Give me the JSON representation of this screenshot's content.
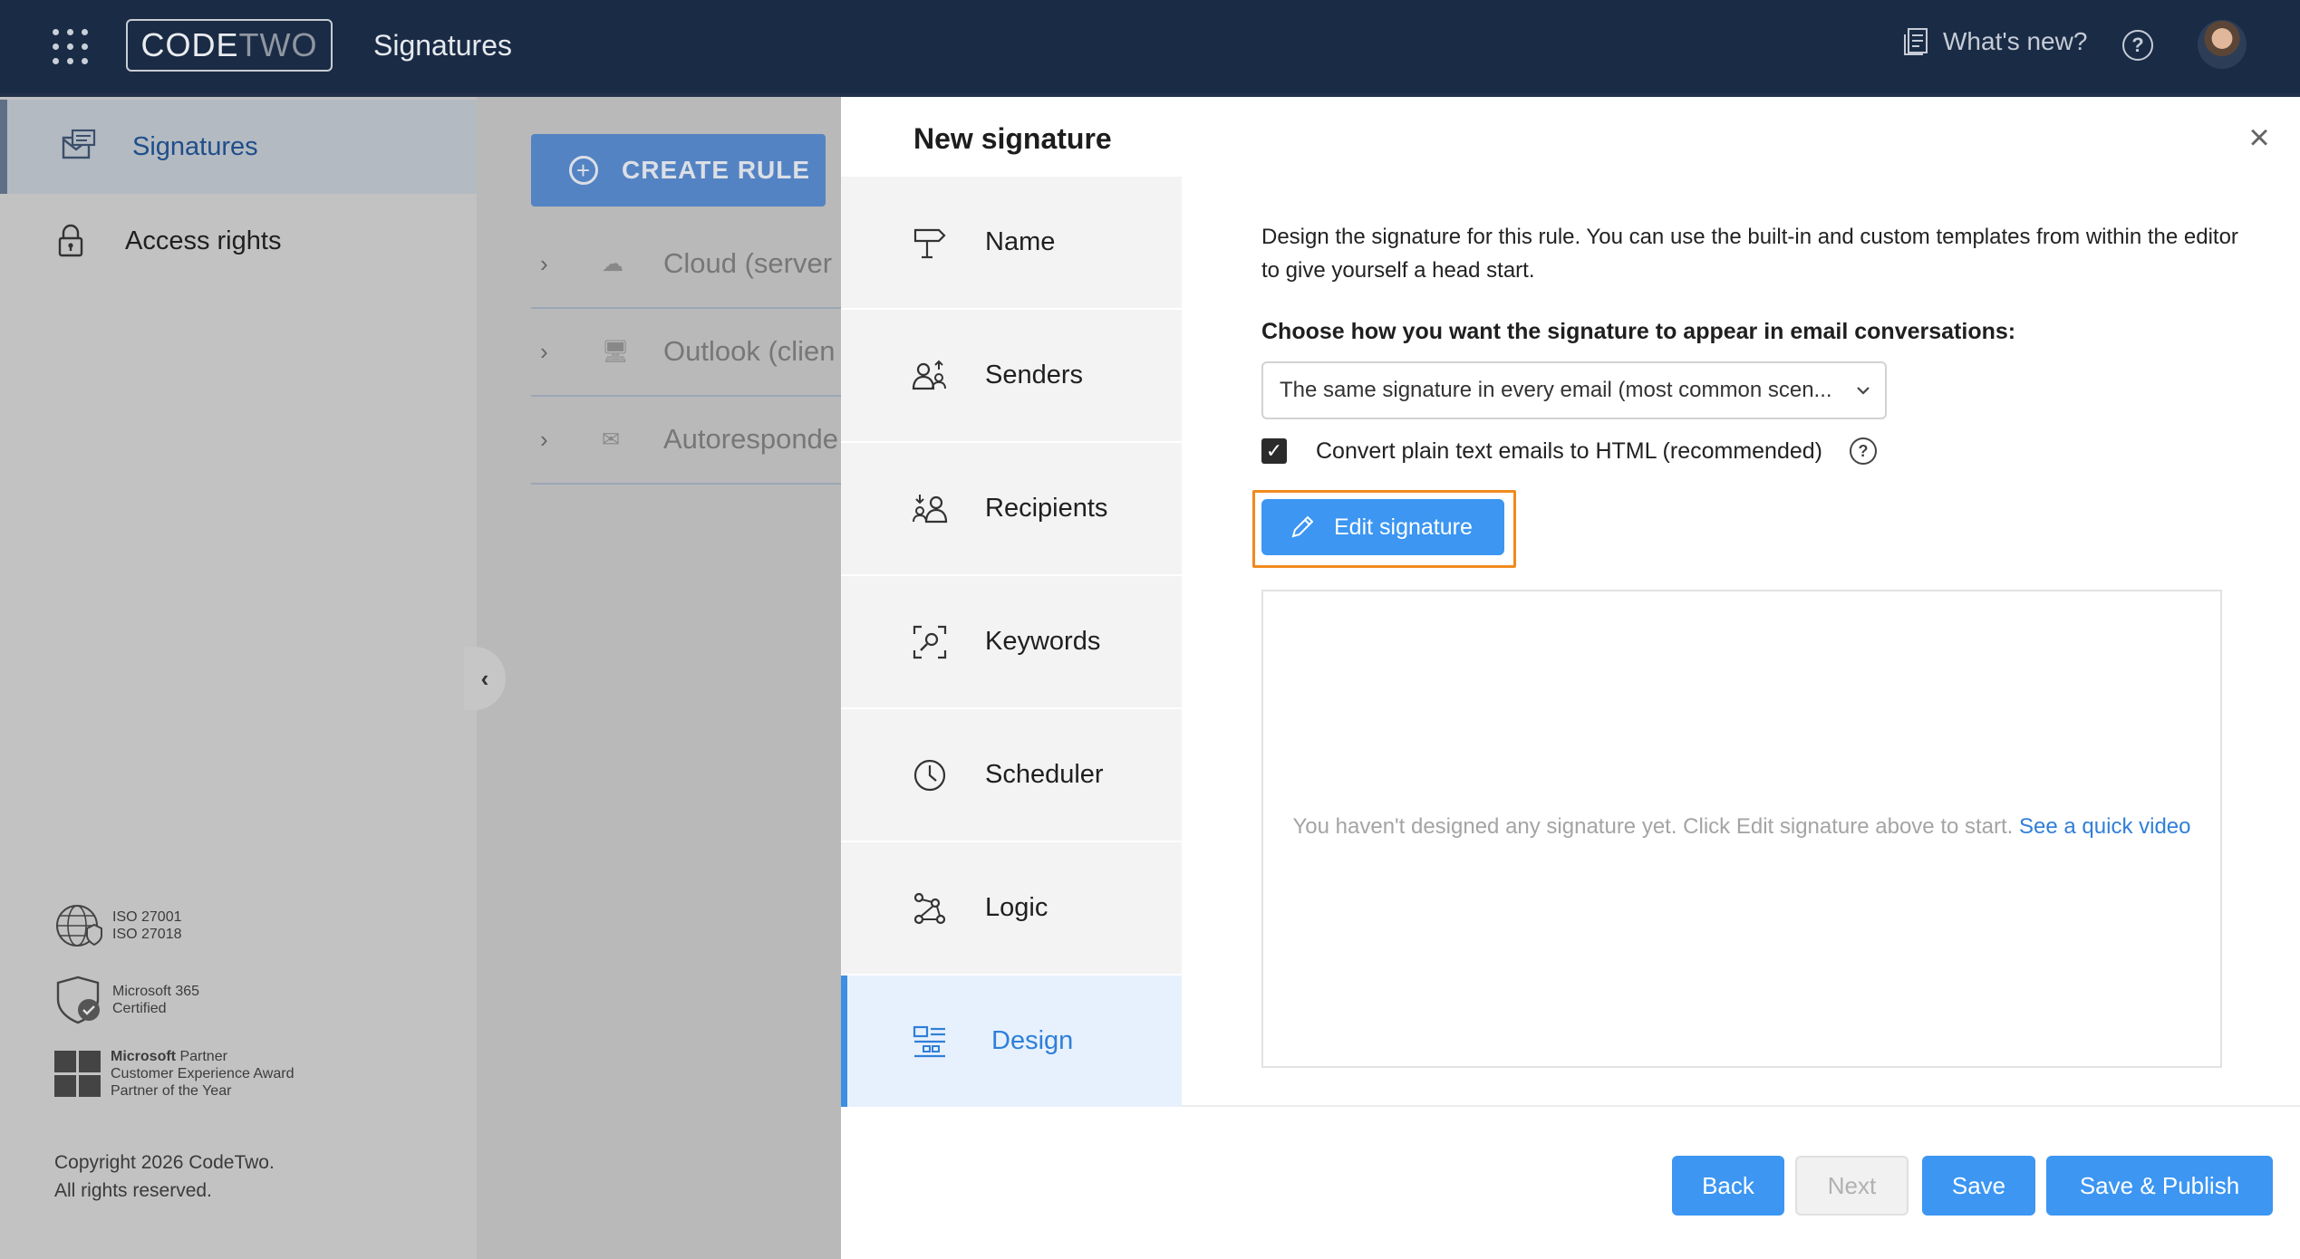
{
  "topbar": {
    "logo_part1": "CODE",
    "logo_part2": "TWO",
    "app_title": "Signatures",
    "whats_new": "What's new?",
    "help": "?"
  },
  "leftnav": {
    "items": [
      {
        "label": "Signatures",
        "icon": "envelope-signature-icon",
        "active": true
      },
      {
        "label": "Access rights",
        "icon": "lock-icon",
        "active": false
      }
    ],
    "badges": {
      "iso": [
        "ISO 27001",
        "ISO 27018"
      ],
      "m365": [
        "Microsoft 365",
        "Certified"
      ],
      "partner": [
        "Microsoft",
        "Partner",
        "Customer Experience Award",
        "Partner of the Year"
      ]
    },
    "copyright_line1": "Copyright 2026 CodeTwo.",
    "copyright_line2": "All rights reserved."
  },
  "rules": {
    "create_label": "CREATE RULE",
    "rows": [
      {
        "label": "Cloud (server",
        "icon": "cloud-icon"
      },
      {
        "label": "Outlook (clien",
        "icon": "monitor-icon"
      },
      {
        "label": "Autoresponde",
        "icon": "mail-reply-icon"
      }
    ]
  },
  "dialog": {
    "title": "New signature",
    "steps": [
      {
        "label": "Name",
        "icon": "signpost-icon"
      },
      {
        "label": "Senders",
        "icon": "senders-icon"
      },
      {
        "label": "Recipients",
        "icon": "recipients-icon"
      },
      {
        "label": "Keywords",
        "icon": "keywords-icon"
      },
      {
        "label": "Scheduler",
        "icon": "clock-icon"
      },
      {
        "label": "Logic",
        "icon": "logic-icon"
      },
      {
        "label": "Design",
        "icon": "design-icon",
        "active": true
      }
    ],
    "description": "Design the signature for this rule. You can use the built-in and custom templates from within the editor to give yourself a head start.",
    "choose_label": "Choose how you want the signature to appear in email conversations:",
    "select_value": "The same signature in every email (most common scen...",
    "convert_label": "Convert plain text emails to HTML (recommended)",
    "convert_checked": true,
    "edit_button": "Edit signature",
    "preview_message": "You haven't designed any signature yet. Click Edit signature above to start.",
    "preview_link": "See a quick video",
    "buttons": {
      "back": "Back",
      "next": "Next",
      "save": "Save",
      "save_publish": "Save & Publish"
    }
  },
  "colors": {
    "topbar": "#1a2b45",
    "accent": "#3c96f2",
    "highlight": "#f08a1f"
  }
}
